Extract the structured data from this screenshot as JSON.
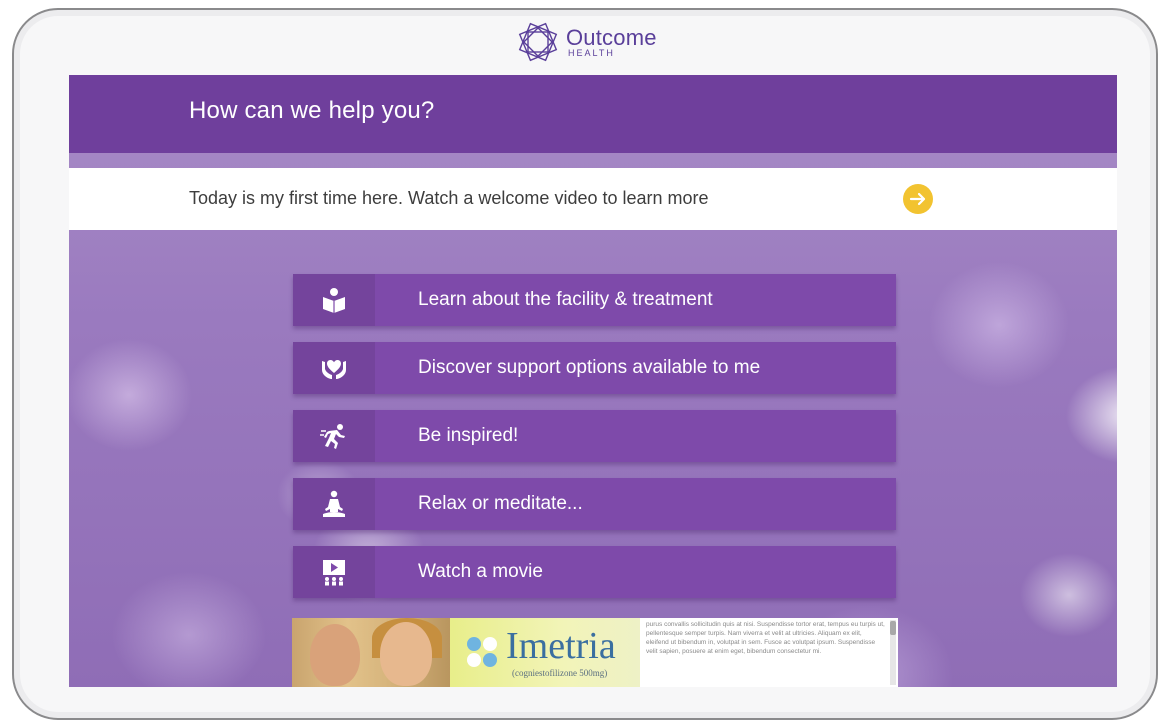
{
  "brand": {
    "name": "Outcome",
    "sub": "HEALTH",
    "color": "#5a3f9a"
  },
  "header": {
    "title": "How can we help you?"
  },
  "welcome": {
    "text": "Today is my first time here. Watch a welcome video to learn more",
    "arrow_icon": "arrow-right-icon",
    "arrow_color": "#f2c330"
  },
  "menu": [
    {
      "label": "Learn about the facility & treatment",
      "icon": "open-book-icon"
    },
    {
      "label": "Discover support options available to me",
      "icon": "hands-heart-icon"
    },
    {
      "label": "Be inspired!",
      "icon": "running-person-icon"
    },
    {
      "label": "Relax or meditate...",
      "icon": "meditation-icon"
    },
    {
      "label": "Watch a movie",
      "icon": "movie-theater-icon"
    }
  ],
  "ad": {
    "brand": "Imetria",
    "subtitle": "(cogniestofilizone 500mg)",
    "body": "purus convallis sollicitudin quis at nisi. Suspendisse tortor erat, tempus eu turpis ut, pellentesque semper turpis. Nam viverra et velit at ultricies. Aliquam ex elit, eleifend ut bibendum in, volutpat in sem. Fusce ac volutpat ipsum. Suspendisse velit sapien, posuere at enim eget, bibendum consectetur mi."
  },
  "colors": {
    "header": "#6f3f9c",
    "menu_item": "#7e4aaa",
    "accent": "#f2c330"
  }
}
